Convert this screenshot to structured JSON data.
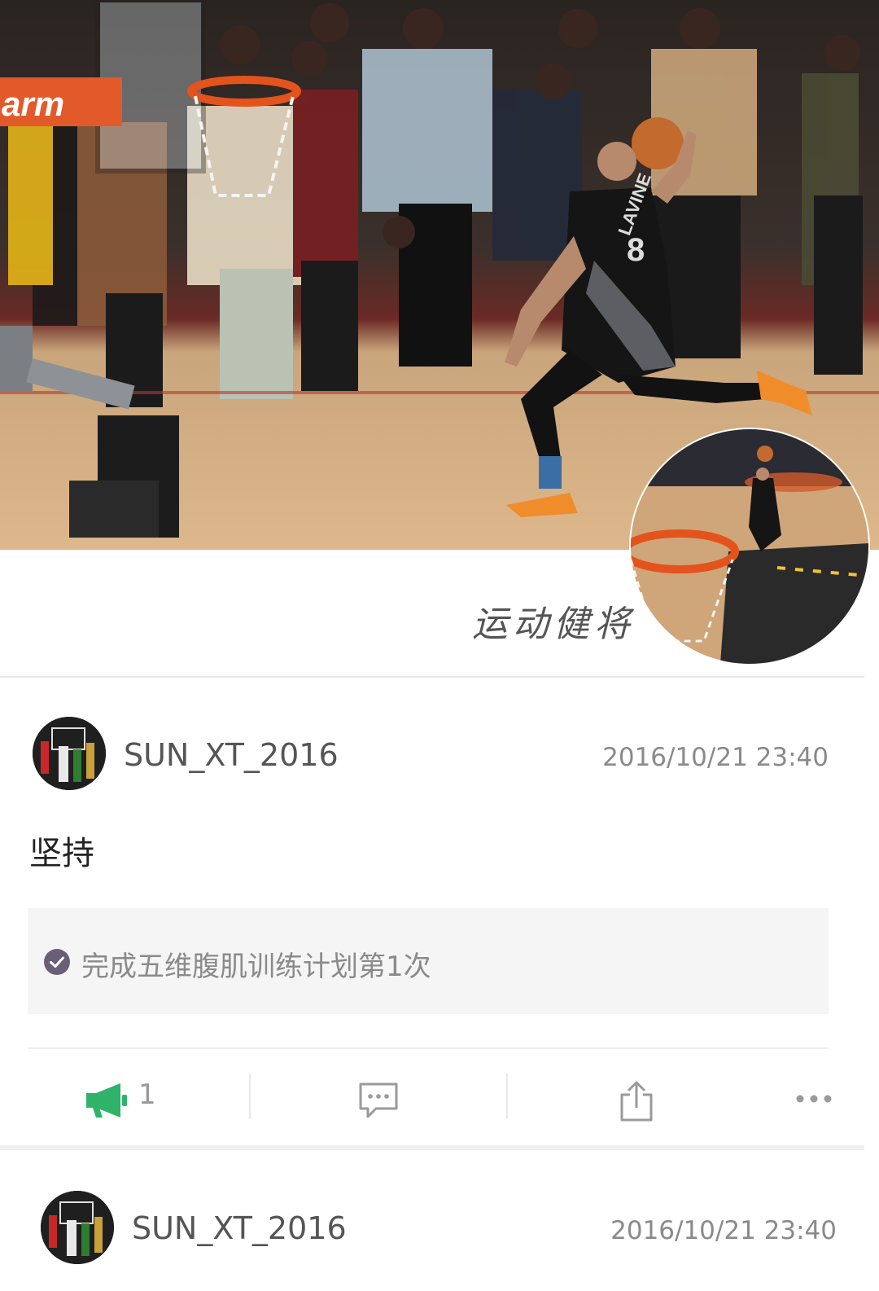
{
  "hero": {
    "slogan": "运动健将",
    "banner_text": "arm",
    "jersey_text": "LAVINE",
    "jersey_number": "8"
  },
  "posts": [
    {
      "username": "SUN_XT_2016",
      "timestamp": "2016/10/21 23:40",
      "text": "坚持",
      "checkin": "完成五维腹肌训练计划第1次",
      "like_count": "1"
    },
    {
      "username": "SUN_XT_2016",
      "timestamp": "2016/10/21 23:40"
    }
  ],
  "icons": {
    "like": "megaphone-icon",
    "comment": "comment-bubble-icon",
    "share": "share-icon",
    "more": "more-dots-icon",
    "check": "check-circle-icon"
  },
  "colors": {
    "like_green": "#2fb36b",
    "icon_gray": "#9a9a9a",
    "check_purple": "#6b5f77"
  }
}
